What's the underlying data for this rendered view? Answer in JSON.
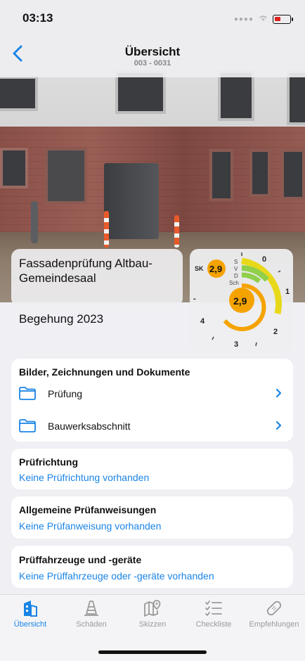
{
  "status_bar": {
    "time": "03:13"
  },
  "nav": {
    "title": "Übersicht",
    "subtitle": "003 - 0031"
  },
  "hero": {
    "title": "Fassadenprüfung Altbau-Gemeindesaal",
    "subtitle": "Begehung 2023"
  },
  "gauge": {
    "sk_label": "SK",
    "sk_value": "2,9",
    "main_value": "2,9",
    "categories": [
      "S",
      "V",
      "D",
      "Sch"
    ],
    "scale_labels": [
      "0",
      "1",
      "2",
      "3",
      "4",
      "-"
    ],
    "colors": {
      "badge": "#f5a300",
      "yellow": "#e8d81a",
      "green": "#8fcf4a",
      "orange": "#f5a300"
    }
  },
  "documents": {
    "title": "Bilder, Zeichnungen und Dokumente",
    "items": [
      {
        "label": "Prüfung",
        "icon": "folder-icon"
      },
      {
        "label": "Bauwerksabschnitt",
        "icon": "folder-icon"
      }
    ]
  },
  "pruefrichtung": {
    "title": "Prüfrichtung",
    "value": "Keine Prüfrichtung vorhanden"
  },
  "anweisungen": {
    "title": "Allgemeine Prüfanweisungen",
    "value": "Keine Prüfanweisung vorhanden"
  },
  "fahrzeuge": {
    "title": "Prüffahrzeuge und -geräte",
    "value": "Keine Prüffahrzeuge oder -geräte vorhanden"
  },
  "tabbar": {
    "items": [
      {
        "label": "Übersicht",
        "icon": "building-icon",
        "active": true
      },
      {
        "label": "Schäden",
        "icon": "traffic-cone-icon",
        "active": false
      },
      {
        "label": "Skizzen",
        "icon": "map-pin-icon",
        "active": false
      },
      {
        "label": "Checkliste",
        "icon": "checklist-icon",
        "active": false
      },
      {
        "label": "Empfehlungen",
        "icon": "bandage-icon",
        "active": false
      }
    ]
  },
  "colors": {
    "accent": "#1a84e6",
    "background": "#efeff4"
  }
}
